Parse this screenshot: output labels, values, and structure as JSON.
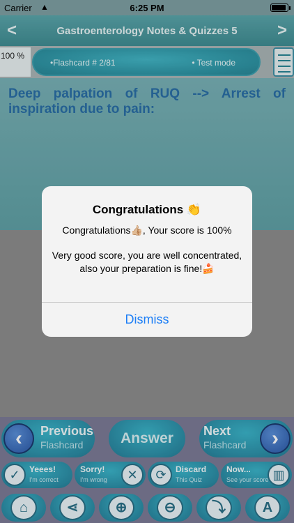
{
  "status": {
    "carrier": "Carrier",
    "wifi_icon": "▲",
    "time": "6:25 PM",
    "battery_level": 0.95
  },
  "nav": {
    "title": "Gastroenterology Notes & Quizzes 5",
    "prev": "<",
    "next": ">"
  },
  "info": {
    "score": "100 %",
    "flashcard": "•Flashcard #  2/81",
    "mode": "• Test mode"
  },
  "question": "Deep palpation of RUQ --> Arrest of inspiration due to pain:",
  "controls": {
    "previous": {
      "title": "Previous",
      "subtitle": "Flashcard",
      "icon": "‹"
    },
    "answer": "Answer",
    "next": {
      "title": "Next",
      "subtitle": "Flashcard",
      "icon": "›"
    },
    "mid": [
      {
        "title": "Yeees!",
        "subtitle": "I'm correct",
        "icon": "✓"
      },
      {
        "title": "Sorry!",
        "subtitle": "I'm wrong",
        "icon": "✕"
      },
      {
        "title": "Discard",
        "subtitle": "This Quiz",
        "icon": "⟳"
      },
      {
        "title": "Now...",
        "subtitle": "See your score",
        "icon": "▥"
      }
    ],
    "tools": [
      "⌂",
      "⋖",
      "⊕",
      "⊖",
      "⤵",
      "A"
    ]
  },
  "alert": {
    "title": "Congratulations 👏",
    "message1": "Congratulations👍🏼, Your score is 100%",
    "message2": "Very good score, you are well concentrated, also your preparation is fine!🍰",
    "button": "Dismiss"
  }
}
